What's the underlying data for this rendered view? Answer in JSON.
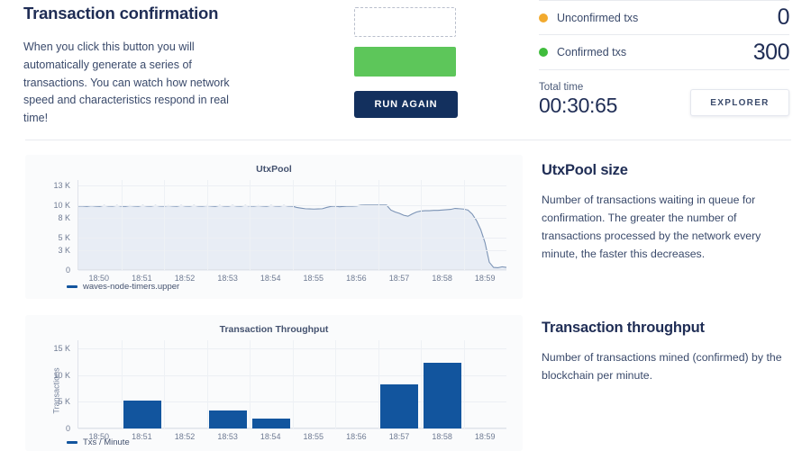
{
  "intro": {
    "title": "Transaction confirmation",
    "body": "When you click this button you will automatically generate a series of transactions. You can watch how network speed and characteristics respond in real time!",
    "run_button_label": "RUN AGAIN",
    "pending_box_name": "unconfirmed-progress-box",
    "done_box_name": "confirmed-progress-box"
  },
  "stats": {
    "unconfirmed": {
      "label": "Unconfirmed txs",
      "value": "0",
      "dot_color": "#f2aa2e"
    },
    "confirmed": {
      "label": "Confirmed txs",
      "value": "300",
      "dot_color": "#3fbc3c"
    },
    "total_time": {
      "label": "Total time",
      "value": "00:30:65"
    },
    "explorer_button_label": "EXPLORER"
  },
  "utxpool_section": {
    "title": "UtxPool size",
    "body": "Number of transactions waiting in queue for confirmation. The greater the number of transactions processed by the network every minute, the faster this decreases."
  },
  "throughput_section": {
    "title": "Transaction throughput",
    "body": "Number of transactions mined (confirmed) by the blockchain per minute."
  },
  "chart_data": [
    {
      "id": "utxpool",
      "type": "area",
      "title": "UtxPool",
      "xlabel": "",
      "ylabel": "",
      "legend": [
        {
          "name": "waves-node-timers.upper",
          "color": "#1c5fa8"
        }
      ],
      "legend_position": "bottom-left",
      "grid": true,
      "yticks": [
        0,
        3000,
        5000,
        8000,
        10000,
        13000
      ],
      "ytick_labels": [
        "0",
        "3 K",
        "5 K",
        "8 K",
        "10 K",
        "13 K"
      ],
      "ylim": [
        0,
        13800
      ],
      "xticks": [
        "18:50",
        "18:51",
        "18:52",
        "18:53",
        "18:54",
        "18:55",
        "18:56",
        "18:57",
        "18:58",
        "18:59"
      ],
      "xlim": [
        "18:49:40",
        "18:59:40"
      ],
      "line_color": "#7b93b5",
      "fill_color": "#e8edf5",
      "x": [
        0,
        1,
        2,
        3,
        4,
        5,
        6,
        7,
        8,
        9,
        10,
        11,
        12,
        13,
        14,
        15,
        16,
        17,
        18,
        19,
        20,
        21,
        22,
        23,
        24,
        25,
        26,
        27,
        28,
        29,
        30,
        31,
        32,
        33,
        34,
        35,
        36,
        37,
        38,
        39,
        40,
        41,
        42,
        43,
        44,
        45,
        46,
        47,
        48,
        49,
        50,
        51,
        52,
        53,
        54,
        55,
        56,
        57,
        58,
        59,
        60,
        61,
        62,
        63,
        64,
        65,
        66,
        67,
        68,
        69,
        70,
        71,
        72,
        73,
        74,
        75,
        76,
        77,
        78,
        79,
        80,
        81,
        82,
        83,
        84,
        85,
        86,
        87,
        88,
        89,
        90,
        91,
        92,
        93,
        94,
        95,
        96,
        97,
        98,
        99,
        100
      ],
      "values": [
        9800,
        9800,
        9760,
        9850,
        9790,
        9760,
        9900,
        9800,
        9780,
        9900,
        9790,
        9760,
        9880,
        9800,
        9770,
        9900,
        9810,
        9780,
        9900,
        9800,
        9780,
        9880,
        9800,
        9770,
        9900,
        9800,
        9790,
        9900,
        9800,
        9780,
        9870,
        9800,
        9760,
        9900,
        9800,
        9790,
        9900,
        9810,
        9780,
        9900,
        9800,
        9780,
        9880,
        9800,
        9770,
        9900,
        9810,
        9780,
        9900,
        9800,
        9790,
        9600,
        9500,
        9400,
        9380,
        9350,
        9370,
        9400,
        9600,
        9750,
        9800,
        9700,
        9750,
        9800,
        9780,
        9820,
        9950,
        9960,
        9960,
        9960,
        9960,
        9960,
        9960,
        9200,
        8900,
        8700,
        8400,
        8250,
        8600,
        8900,
        9050,
        9100,
        9100,
        9150,
        9150,
        9200,
        9250,
        9300,
        9450,
        9400,
        9350,
        9200,
        8600,
        7600,
        6200,
        4200,
        1200,
        400,
        350,
        500,
        400
      ]
    },
    {
      "id": "throughput",
      "type": "bar",
      "title": "Transaction Throughput",
      "xlabel": "",
      "ylabel": "Transactions",
      "legend": [
        {
          "name": "Txs / Minute",
          "color": "#1c5fa8"
        }
      ],
      "legend_position": "bottom-left",
      "grid": true,
      "yticks": [
        0,
        5000,
        10000,
        15000
      ],
      "ytick_labels": [
        "0",
        "5 K",
        "10 K",
        "15 K"
      ],
      "ylim": [
        0,
        16500
      ],
      "xticks": [
        "18:50",
        "18:51",
        "18:52",
        "18:53",
        "18:54",
        "18:55",
        "18:56",
        "18:57",
        "18:58",
        "18:59"
      ],
      "bar_color": "#12559e",
      "categories": [
        "18:50",
        "18:51",
        "18:52",
        "18:53",
        "18:54",
        "18:55",
        "18:56",
        "18:57",
        "18:58",
        "18:59"
      ],
      "values": [
        0,
        5200,
        0,
        3300,
        1900,
        0,
        0,
        8200,
        12300,
        0
      ]
    }
  ],
  "colors": {
    "brand_navy": "#13305e",
    "accent_green": "#5dc65a",
    "amber": "#f2aa2e",
    "bar_blue": "#12559e",
    "line_blue": "#7b93b5"
  }
}
